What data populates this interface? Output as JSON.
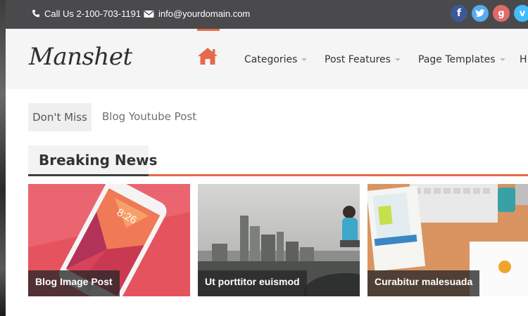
{
  "topbar": {
    "phone": "Call Us 2-100-703-1191",
    "email": "info@yourdomain.com",
    "social": [
      "facebook-icon",
      "twitter-icon",
      "google-plus-icon",
      "vimeo-icon"
    ]
  },
  "header": {
    "logo": "Manshet",
    "nav": [
      {
        "label": "Categories"
      },
      {
        "label": "Post Features"
      },
      {
        "label": "Page Templates"
      },
      {
        "label": "H"
      }
    ]
  },
  "dont_miss": {
    "label": "Don't Miss",
    "link": "Blog Youtube Post"
  },
  "breaking_news": {
    "title": "Breaking News",
    "cards": [
      {
        "caption": "Blog Image Post"
      },
      {
        "caption": "Ut porttitor euismod"
      },
      {
        "caption": "Curabitur malesuada"
      }
    ]
  },
  "colors": {
    "accent": "#e56a4c",
    "topbar": "#4a4a4c",
    "header_bg": "#f5f5f5"
  }
}
